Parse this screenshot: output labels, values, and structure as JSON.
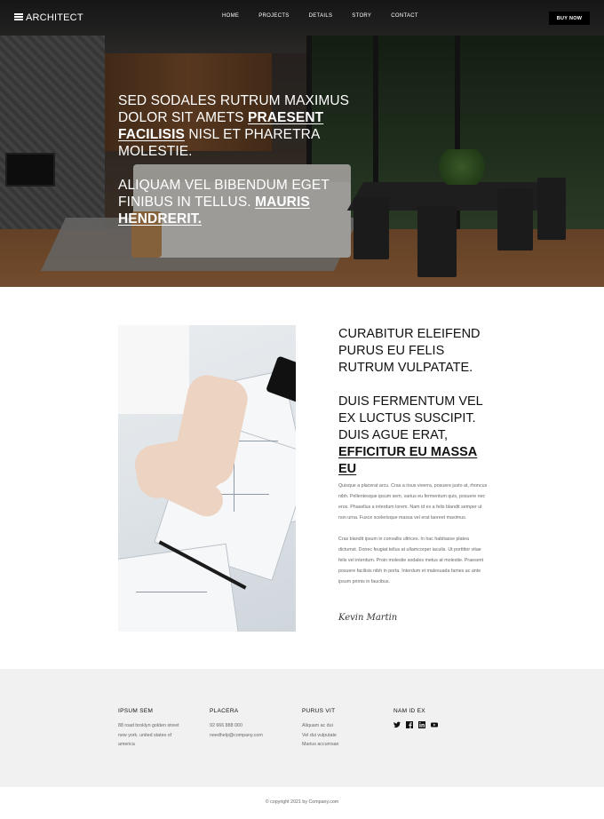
{
  "nav": {
    "logo_text": "ARCHITECT",
    "menu": [
      "HOME",
      "PROJECTS",
      "DETAILS",
      "STORY",
      "CONTACT"
    ],
    "buy_label": "BUY NOW"
  },
  "hero": {
    "para1_text": "SED SODALES RUTRUM MAXIMUS DOLOR SIT AMETS ",
    "para1_link": "PRAESENT FACILISIS",
    "para1_tail": " NISL ET PHARETRA MOLESTIE.",
    "para2_text": "ALIQUAM VEL BIBENDUM EGET FINIBUS IN TELLUS. ",
    "para2_link": "MAURIS HENDRERIT."
  },
  "main": {
    "heading1": "CURABITUR ELEIFEND PURUS EU FELIS RUTRUM VULPATATE.",
    "heading2_text": "DUIS FERMENTUM VEL EX LUCTUS SUSCIPIT. DUIS AGUE ERAT, ",
    "heading2_link": "EFFICITUR EU MASSA EU",
    "body1": "Quisque a placerat arcu. Cras a risus viverra, posuere justo at, rhoncus nibh. Pellentesque ipsum sem, varius eu fermentum quis, posuere nec eros. Phasellus a interdum lorem. Nam id ex a felis blandit semper ut non urna. Fusce scelerisque massa vel erat laoreet maximus.",
    "body2": "Cras blandit ipsum in convallis ultrices. In hac habitasse platea dictumst. Donec feugiat tellus at ullamcorper iaculis. Ut porttitor vitae felis vel interdum. Proin molestie sodales metus at molestie. Praesent posuere facilisis nibh in porta. Interdum et malesuada fames ac ante ipsum primis in faucibus.",
    "signature": "Kevin Martin"
  },
  "footer": {
    "col1": {
      "heading": "IPSUM SEM",
      "lines": [
        "88 road broklyn golden street",
        "new york. united states of",
        "america"
      ]
    },
    "col2": {
      "heading": "PLACERA",
      "lines": [
        "92 666 888 000",
        "needhelp@company.com"
      ]
    },
    "col3": {
      "heading": "PURUS VIT",
      "lines": [
        "Aliquam ac dui",
        "Vel dui vulputate",
        "Marius accumsan"
      ]
    },
    "col4": {
      "heading": "NAM ID EX",
      "socials": [
        "twitter-icon",
        "facebook-icon",
        "linkedin-icon",
        "youtube-icon"
      ]
    },
    "copyright": "© copyright 2021 by Company.com"
  }
}
